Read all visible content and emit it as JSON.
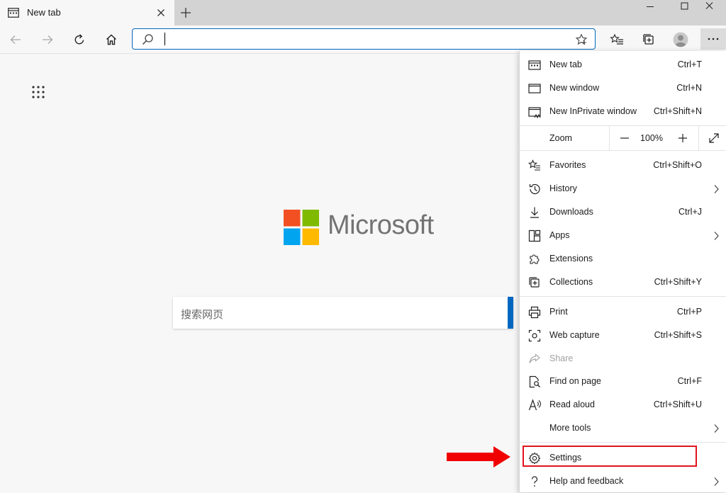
{
  "tab": {
    "title": "New tab"
  },
  "addressbar": {
    "value": "",
    "placeholder": ""
  },
  "page": {
    "logo_text": "Microsoft",
    "search_placeholder": "搜索网页",
    "logo_colors": [
      "#f25022",
      "#7fba00",
      "#00a4ef",
      "#ffb900"
    ]
  },
  "menu": {
    "new_tab": {
      "label": "New tab",
      "shortcut": "Ctrl+T"
    },
    "new_window": {
      "label": "New window",
      "shortcut": "Ctrl+N"
    },
    "new_inprivate": {
      "label": "New InPrivate window",
      "shortcut": "Ctrl+Shift+N"
    },
    "zoom": {
      "label": "Zoom",
      "value": "100%"
    },
    "favorites": {
      "label": "Favorites",
      "shortcut": "Ctrl+Shift+O"
    },
    "history": {
      "label": "History"
    },
    "downloads": {
      "label": "Downloads",
      "shortcut": "Ctrl+J"
    },
    "apps": {
      "label": "Apps"
    },
    "extensions": {
      "label": "Extensions"
    },
    "collections": {
      "label": "Collections",
      "shortcut": "Ctrl+Shift+Y"
    },
    "print": {
      "label": "Print",
      "shortcut": "Ctrl+P"
    },
    "web_capture": {
      "label": "Web capture",
      "shortcut": "Ctrl+Shift+S"
    },
    "share": {
      "label": "Share"
    },
    "find_on_page": {
      "label": "Find on page",
      "shortcut": "Ctrl+F"
    },
    "read_aloud": {
      "label": "Read aloud",
      "shortcut": "Ctrl+Shift+U"
    },
    "more_tools": {
      "label": "More tools"
    },
    "settings": {
      "label": "Settings"
    },
    "help_feedback": {
      "label": "Help and feedback"
    }
  },
  "colors": {
    "accent": "#0067c0",
    "highlight": "#e0141e",
    "brand_text": "#737373"
  }
}
